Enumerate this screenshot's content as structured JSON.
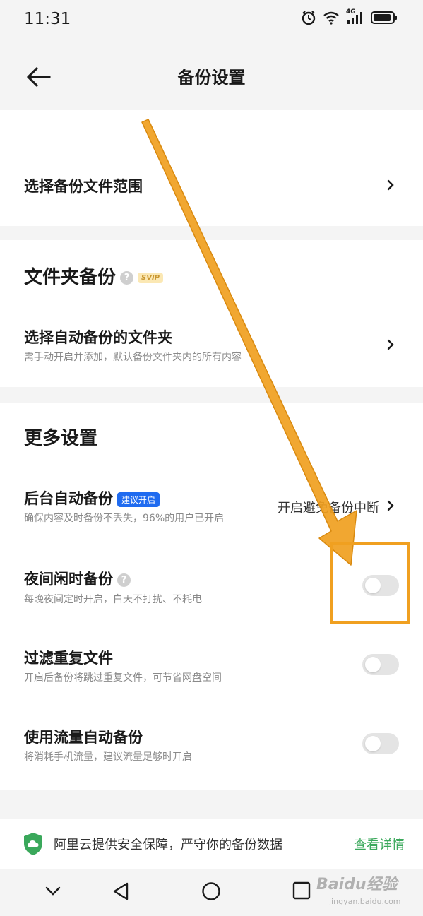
{
  "status": {
    "time": "11:31",
    "icons": [
      "alarm-icon",
      "wifi-icon",
      "signal-4g-icon",
      "battery-icon"
    ],
    "network_label": "4G"
  },
  "header": {
    "title": "备份设置",
    "back_icon": "arrow-left-icon"
  },
  "basic": {
    "scope_title": "选择备份文件范围"
  },
  "folder_backup": {
    "section_title": "文件夹备份",
    "help_mark": "?",
    "svip_badge": "SVIP",
    "row_title": "选择自动备份的文件夹",
    "row_sub": "需手动开启并添加，默认备份文件夹内的所有内容"
  },
  "more_settings": {
    "section_title": "更多设置",
    "background_backup": {
      "title": "后台自动备份",
      "badge": "建议开启",
      "sub": "确保内容及时备份不丢失，96%的用户已开启",
      "value": "开启避免备份中断"
    },
    "night_backup": {
      "title": "夜间闲时备份",
      "help_mark": "?",
      "sub": "每晚夜间定时开启，白天不打扰、不耗电",
      "enabled": false
    },
    "filter_duplicates": {
      "title": "过滤重复文件",
      "sub": "开启后备份将跳过重复文件，可节省网盘空间",
      "enabled": false
    },
    "cellular_backup": {
      "title": "使用流量自动备份",
      "sub": "将消耗手机流量，建议流量足够时开启",
      "enabled": false
    }
  },
  "footer": {
    "text": "阿里云提供安全保障，严守你的备份数据",
    "link": "查看详情"
  },
  "navbar": {
    "icons": [
      "chevron-down-icon",
      "triangle-back-icon",
      "circle-home-icon",
      "square-recents-icon"
    ]
  },
  "annotation": {
    "color": "#f0a020"
  },
  "watermark": {
    "brand": "Baidu经验",
    "url": "jingyan.baidu.com"
  },
  "colors": {
    "accent_green": "#3aa85b",
    "badge_blue": "#1f6bf0",
    "svip_gold": "#c9962f"
  }
}
